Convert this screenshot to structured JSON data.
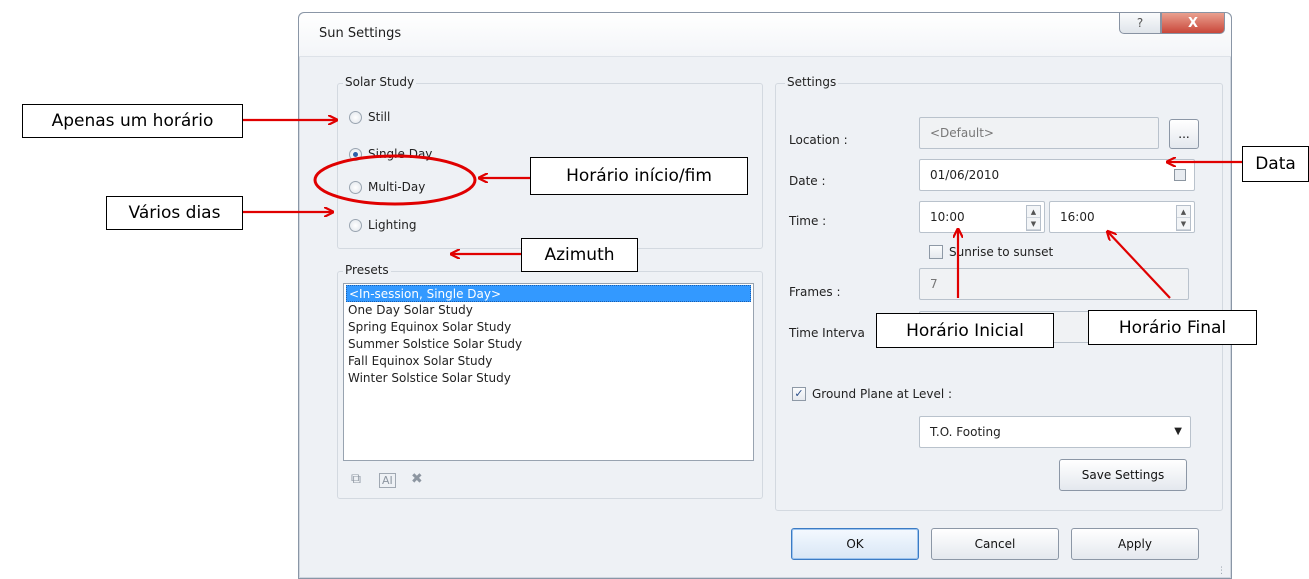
{
  "dialog": {
    "title": "Sun Settings",
    "help_glyph": "?",
    "close_glyph": "X",
    "solar_study": {
      "label": "Solar Study",
      "options": [
        {
          "label": "Still",
          "selected": false
        },
        {
          "label": "Single Day",
          "selected": true
        },
        {
          "label": "Multi-Day",
          "selected": false
        },
        {
          "label": "Lighting",
          "selected": false
        }
      ]
    },
    "presets": {
      "label": "Presets",
      "items": [
        "<In-session, Single Day>",
        "One Day Solar Study",
        "Spring Equinox Solar Study",
        "Summer Solstice Solar Study",
        "Fall Equinox Solar Study",
        "Winter Solstice Solar Study"
      ],
      "selected_index": 0
    },
    "settings": {
      "label": "Settings",
      "location_label": "Location :",
      "location_value": "<Default>",
      "browse_label": "...",
      "date_label": "Date :",
      "date_value": "01/06/2010",
      "time_label": "Time :",
      "time_start": "10:00",
      "time_end": "16:00",
      "sunrise_label": "Sunrise to sunset",
      "sunrise_checked": false,
      "frames_label": "Frames :",
      "frames_value": "7",
      "interval_label": "Time Interva",
      "ground_plane_label": "Ground Plane at Level :",
      "ground_plane_checked": true,
      "level_value": "T.O. Footing",
      "save_settings_label": "Save Settings"
    },
    "buttons": {
      "ok": "OK",
      "cancel": "Cancel",
      "apply": "Apply"
    }
  },
  "annotations": {
    "still": "Apenas um horário",
    "single_day": "Horário início/fim",
    "multi_day": "Vários dias",
    "lighting": "Azimuth",
    "date": "Data",
    "time_start": "Horário Inicial",
    "time_end": "Horário Final"
  },
  "colors": {
    "arrow": "#e00000",
    "selection": "#3399ff",
    "close_button": "#c9473a"
  }
}
